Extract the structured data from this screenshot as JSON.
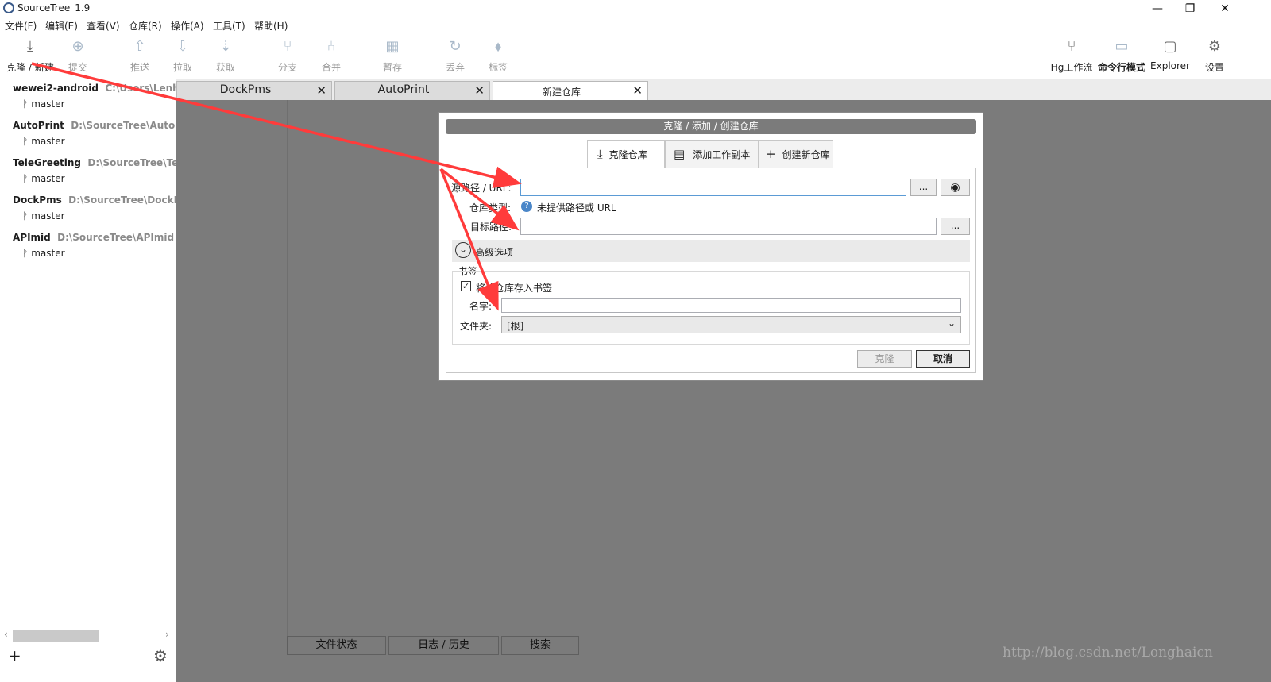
{
  "window": {
    "title": "SourceTree_1.9",
    "min": "—",
    "restore": "❐",
    "close": "✕"
  },
  "menu": [
    "文件(F)",
    "编辑(E)",
    "查看(V)",
    "仓库(R)",
    "操作(A)",
    "工具(T)",
    "帮助(H)"
  ],
  "toolbar": {
    "clone": "克隆 / 新建",
    "commit": "提交",
    "push": "推送",
    "pull": "拉取",
    "fetch": "获取",
    "branch": "分支",
    "merge": "合并",
    "stash": "暂存",
    "discard": "丢弃",
    "tag": "标签",
    "hgflow": "Hg工作流",
    "terminal": "命令行模式",
    "explorer": "Explorer",
    "settings": "设置"
  },
  "icons": {
    "clone": "⤓",
    "commit": "⊕",
    "push": "⇧",
    "pull": "⇩",
    "fetch": "⇣",
    "branch": "⑂",
    "merge": "⑃",
    "stash": "▦",
    "discard": "↻",
    "tag": "⬧",
    "hgflow": "⑂",
    "terminal": "▭",
    "explorer": "▢",
    "settings": "⚙"
  },
  "sidebar": {
    "repos": [
      {
        "name": "wewei2-android",
        "path": "C:\\Users\\Lenhart\\",
        "branch": "master"
      },
      {
        "name": "AutoPrint",
        "path": "D:\\SourceTree\\AutoPrint",
        "branch": "master"
      },
      {
        "name": "TeleGreeting",
        "path": "D:\\SourceTree\\TeleGr",
        "branch": "master"
      },
      {
        "name": "DockPms",
        "path": "D:\\SourceTree\\DockPms",
        "branch": "master"
      },
      {
        "name": "APImid",
        "path": "D:\\SourceTree\\APImid",
        "branch": "master"
      }
    ],
    "branch_glyph": "ᚹ",
    "add": "+",
    "settings": "⚙",
    "scroll_left": "‹",
    "scroll_right": "›"
  },
  "tabs": [
    {
      "label": "DockPms",
      "close": "✕"
    },
    {
      "label": "AutoPrint",
      "close": "✕"
    },
    {
      "label": "新建仓库",
      "close": "✕"
    }
  ],
  "bottom_tabs": [
    "文件状态",
    "日志 / 历史",
    "搜索"
  ],
  "watermark": "http://blog.csdn.net/Longhaicn",
  "dialog": {
    "title": "克隆 / 添加 / 创建仓库",
    "tabs": [
      {
        "icon": "⤓",
        "label": "克隆仓库"
      },
      {
        "icon": "▤",
        "label": "添加工作副本"
      },
      {
        "icon": "+",
        "label": "创建新仓库"
      }
    ],
    "source_label": "源路径 / URL:",
    "source_value": "",
    "browse": "...",
    "remote_icon": "◉",
    "type_label": "仓库类型:",
    "type_icon": "?",
    "type_value": "未提供路径或 URL",
    "dest_label": "目标路径:",
    "dest_value": "",
    "advanced": "高级选项",
    "advanced_icon": "⌄",
    "bookmark_group": "书签",
    "bookmark_check": "将此仓库存入书签",
    "check_mark": "✓",
    "name_label": "名字:",
    "name_value": "",
    "folder_label": "文件夹:",
    "folder_value": "[根]",
    "dropdown_icon": "⌄",
    "clone_button": "克隆",
    "cancel_button": "取消"
  },
  "colors": {
    "annotation_arrow": "#ff3b3b",
    "content_bg": "#7b7b7b",
    "focus_border": "#5b9bd5"
  }
}
